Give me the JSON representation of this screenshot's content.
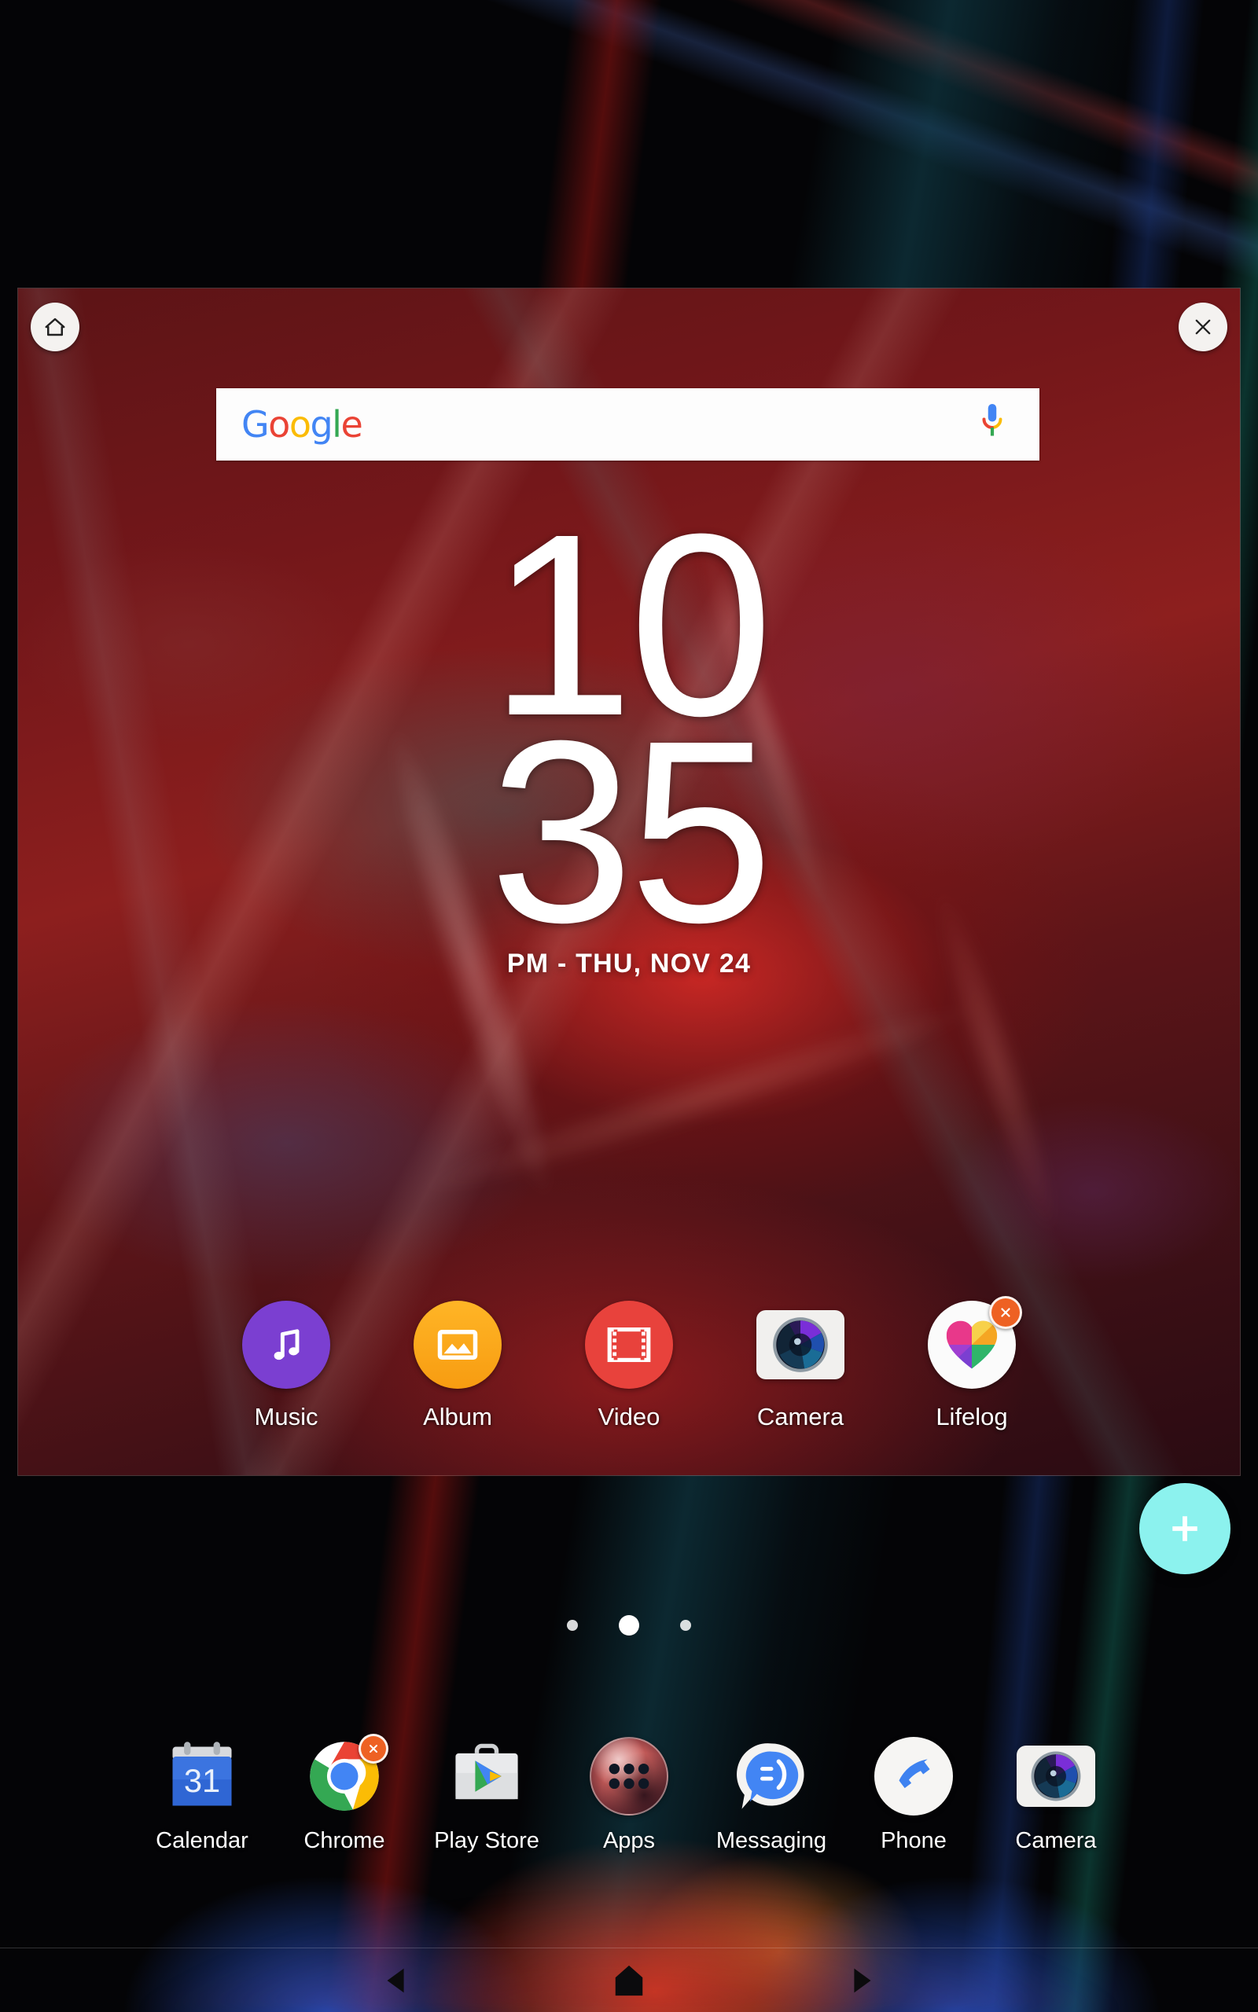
{
  "wallpaper": {
    "name": "abstract-dark-wallpaper"
  },
  "panel": {
    "home_button_icon": "home-icon",
    "close_button_icon": "close-icon"
  },
  "search": {
    "logo_letters": [
      "G",
      "o",
      "o",
      "g",
      "l",
      "e"
    ],
    "logo_text": "Google",
    "mic_icon": "microphone-icon"
  },
  "clock": {
    "hours": "10",
    "minutes": "35",
    "date": "PM - THU, NOV 24"
  },
  "app_row": [
    {
      "label": "Music",
      "icon": "music-note-icon",
      "badge": ""
    },
    {
      "label": "Album",
      "icon": "photo-icon",
      "badge": ""
    },
    {
      "label": "Video",
      "icon": "film-strip-icon",
      "badge": ""
    },
    {
      "label": "Camera",
      "icon": "camera-lens-icon",
      "badge": ""
    },
    {
      "label": "Lifelog",
      "icon": "heart-icon",
      "badge": "remove-badge"
    }
  ],
  "fab": {
    "label": "+",
    "icon": "plus-icon",
    "color": "#8CF2EE"
  },
  "page_indicator": {
    "pages": 3,
    "active": 2
  },
  "dock": [
    {
      "label": "Calendar",
      "icon": "calendar-icon",
      "day": "31",
      "badge": ""
    },
    {
      "label": "Chrome",
      "icon": "chrome-icon",
      "badge": "remove-badge"
    },
    {
      "label": "Play Store",
      "icon": "play-store-icon",
      "badge": ""
    },
    {
      "label": "Apps",
      "icon": "app-drawer-icon",
      "badge": ""
    },
    {
      "label": "Messaging",
      "icon": "message-icon",
      "badge": ""
    },
    {
      "label": "Phone",
      "icon": "phone-icon",
      "badge": ""
    },
    {
      "label": "Camera",
      "icon": "camera-lens-icon",
      "badge": ""
    }
  ],
  "navbar": {
    "back_icon": "back-triangle-icon",
    "home_icon": "home-pentagon-icon",
    "recents_icon": "recents-triangle-icon"
  },
  "colors": {
    "accent_fab": "#8CF2EE",
    "badge": "#EE6123",
    "music": "#7B3FD1",
    "album": "#F7A11A",
    "video": "#E8423C",
    "messaging": "#4285F4",
    "phone": "#3E82F0",
    "calendar": "#3B74E0"
  }
}
